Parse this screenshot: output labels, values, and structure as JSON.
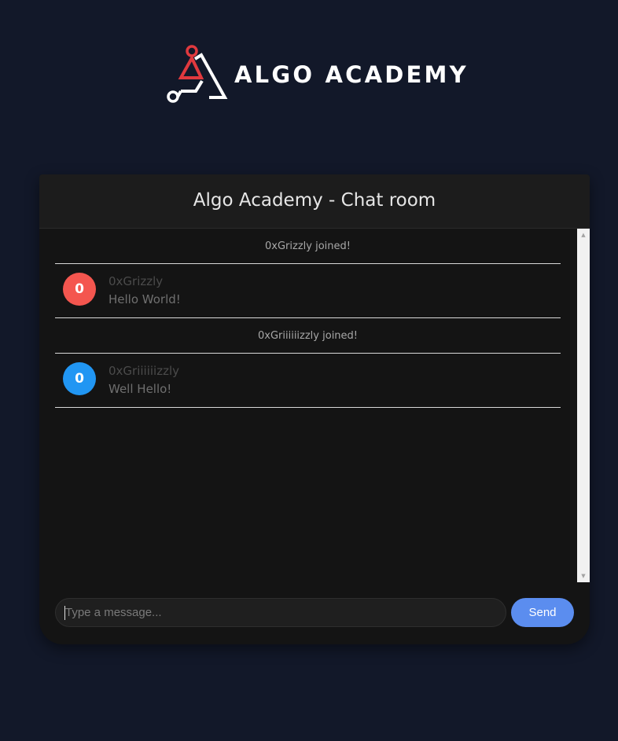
{
  "brand": {
    "name": "ALGO ACADEMY",
    "logo_icon": "algo-academy-logo-icon",
    "accent_red": "#e0393e"
  },
  "chat": {
    "title": "Algo Academy - Chat room",
    "entries": [
      {
        "kind": "event",
        "text": "0xGrizzly joined!"
      },
      {
        "kind": "message",
        "avatar_letter": "0",
        "avatar_color": "#f4564f",
        "user": "0xGrizzly",
        "text": "Hello World!"
      },
      {
        "kind": "event",
        "text": "0xGriiiiiizzly joined!"
      },
      {
        "kind": "message",
        "avatar_letter": "0",
        "avatar_color": "#2196f3",
        "user": "0xGriiiiiizzly",
        "text": "Well Hello!"
      }
    ],
    "input_placeholder": "Type a message...",
    "input_value": "",
    "send_label": "Send",
    "send_color": "#5b8def"
  }
}
